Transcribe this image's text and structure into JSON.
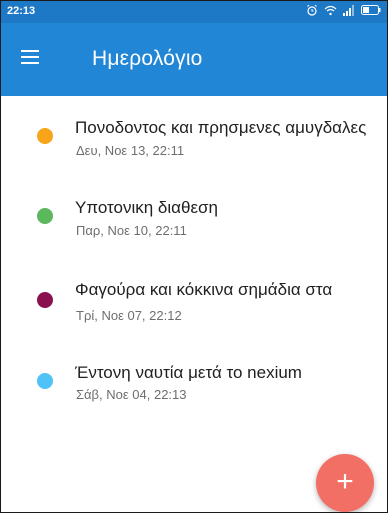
{
  "status_bar": {
    "time": "22:13",
    "icons": [
      "alarm-icon",
      "wifi-icon",
      "signal-icon",
      "battery-icon"
    ]
  },
  "app_bar": {
    "menu_icon": "menu-icon",
    "title": "Ημερολόγιο",
    "color": "#2286d6"
  },
  "entries": [
    {
      "name": "Πονοδοντος και πρησμενες αμυγδαλες",
      "date": "Δευ, Νοε 13, 22:11",
      "color": "#f9a51a"
    },
    {
      "name": "Υποτονικη διαθεση",
      "date": "Παρ, Νοε 10, 22:11",
      "color": "#5cb85c"
    },
    {
      "name": "Φαγούρα και κόκκινα σημάδια στα",
      "date": "Τρί, Νοε 07, 22:12",
      "color": "#8a1150"
    },
    {
      "name": "Έντονη ναυτία μετά το nexium",
      "date": "Σάβ, Νοε 04, 22:13",
      "color": "#4fc3f7"
    }
  ],
  "fab": {
    "label": "+",
    "icon": "plus-icon",
    "color": "#f26f66"
  }
}
